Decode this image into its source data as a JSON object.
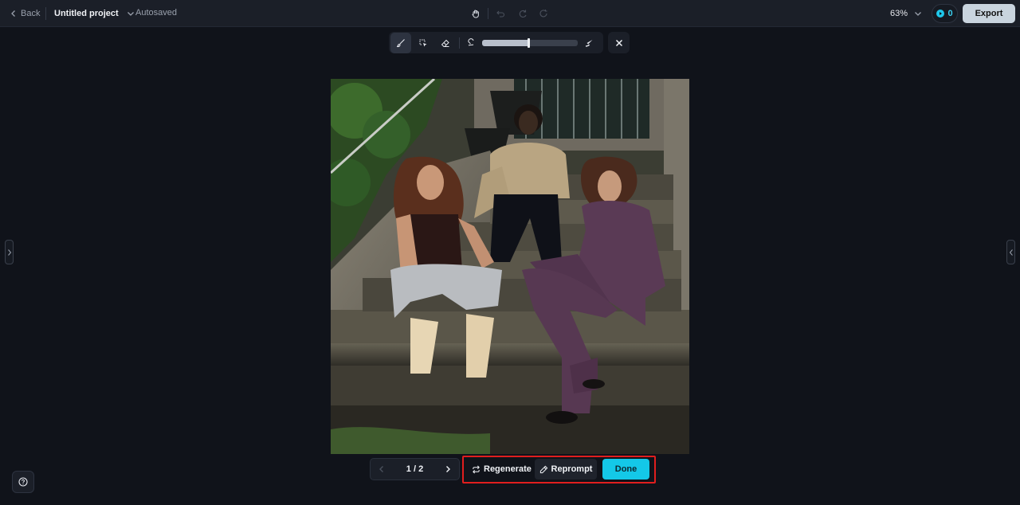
{
  "topbar": {
    "back_label": "Back",
    "project_title": "Untitled project",
    "autosave_status": "Autosaved",
    "zoom": "63%",
    "credits": "0",
    "export_label": "Export"
  },
  "pager": {
    "count": "1 / 2"
  },
  "actions": {
    "regenerate_label": "Regenerate",
    "reprompt_label": "Reprompt",
    "done_label": "Done"
  },
  "brush_size": 0.48,
  "colors": {
    "accent": "#14c8e8",
    "highlight": "#e01e1e",
    "export_bg": "#c9d4de"
  }
}
